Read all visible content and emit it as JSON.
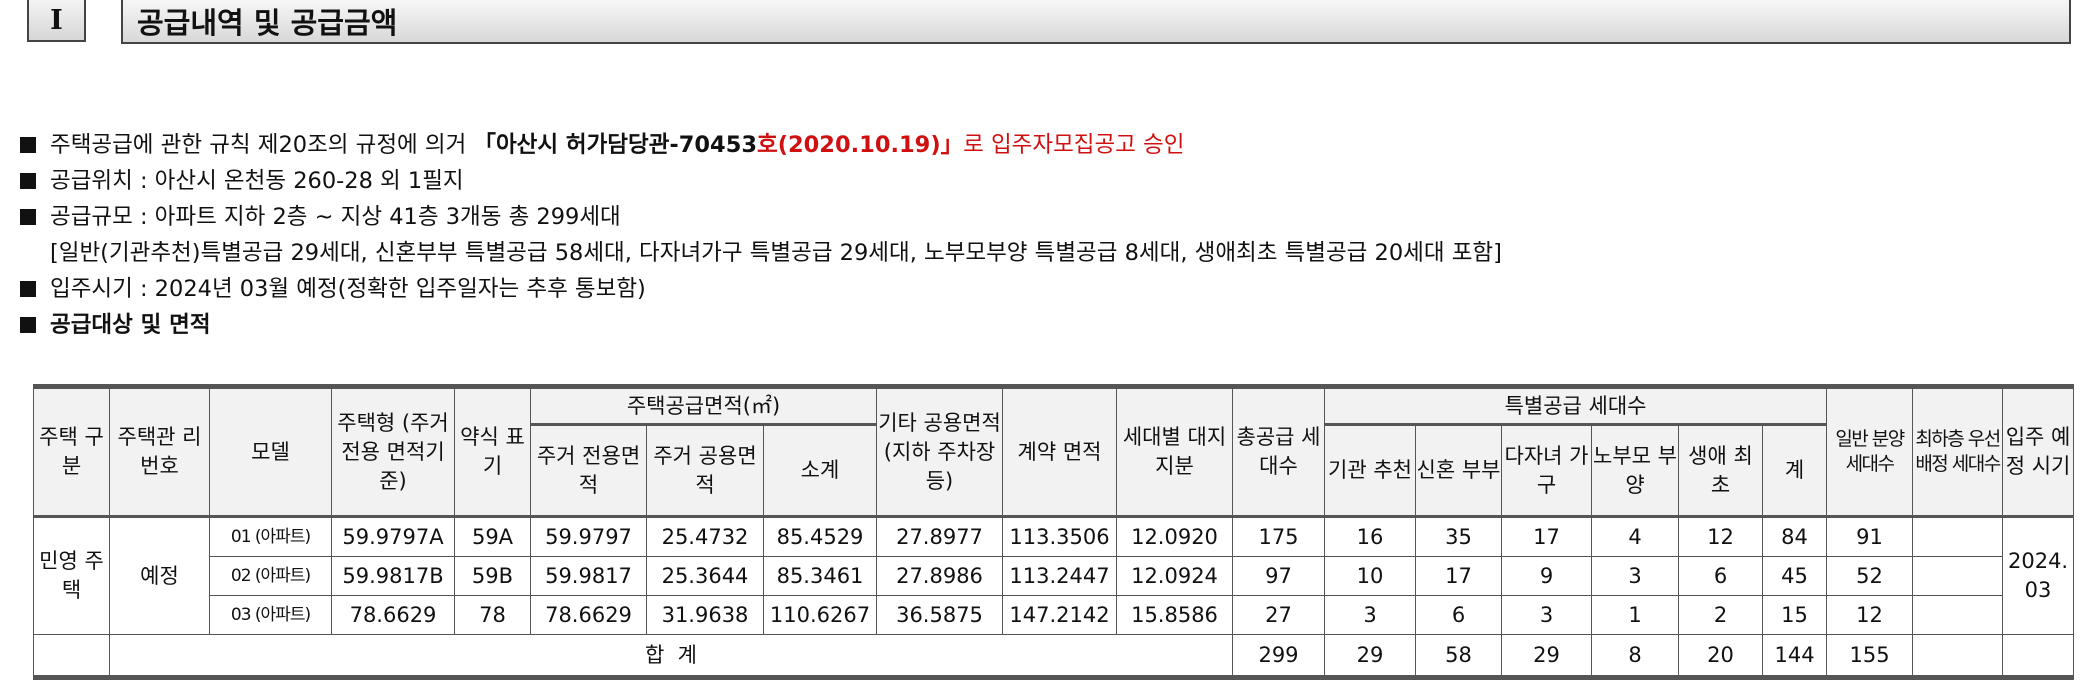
{
  "section": {
    "number": "I",
    "title": "공급내역 및 공급금액"
  },
  "bullets": {
    "b1_prefix": "주택공급에 관한 규칙 제20조의 규정에 의거 ",
    "b1_doc": "「아산시 허가담당관-70453",
    "b1_red": "호(2020.10.19)」",
    "b1_suffix": "로 입주자모집공고 승인",
    "b2": "공급위치 : 아산시 온천동 260-28 외 1필지",
    "b3": "공급규모 : 아파트 지하 2층 ~ 지상 41층 3개동 총 299세대",
    "b3_detail": "[일반(기관추천)특별공급 29세대, 신혼부부 특별공급 58세대, 다자녀가구 특별공급 29세대, 노부모부양 특별공급 8세대, 생애최초 특별공급 20세대 포함]",
    "b4": "입주시기 : 2024년 03월 예정(정확한 입주일자는 추후 통보함)",
    "b5": "공급대상 및 면적"
  },
  "table": {
    "headers": {
      "house_type": "주택 구분",
      "manage_no": "주택관 리번호",
      "model": "모델",
      "house_style": "주택형 (주거전용 면적기준)",
      "abbr": "약식 표기",
      "supply_area": "주택공급면적(㎡)",
      "resid_private": "주거 전용면적",
      "resid_common": "주거 공용면적",
      "subtotal": "소계",
      "other_common": "기타 공용면적 (지하 주차장등)",
      "contract_area": "계약 면적",
      "land_share": "세대별 대지지분",
      "total_units": "총공급 세대수",
      "special": "특별공급 세대수",
      "inst": "기관 추천",
      "newlywed": "신혼 부부",
      "multi_child": "다자녀 가구",
      "elder": "노부모 부양",
      "first_life": "생애 최초",
      "sum": "계",
      "general": "일반 분양 세대수",
      "lowest_floor": "최하층 우선배정 세대수",
      "move_in": "입주 예정 시기"
    },
    "group_label": "민영 주택",
    "manage_value": "예정",
    "move_in_value": "2024. 03",
    "rows": [
      {
        "model": "01 (아파트)",
        "type": "59.9797A",
        "abbr": "59A",
        "priv": "59.9797",
        "common": "25.4732",
        "sub": "85.4529",
        "other": "27.8977",
        "contract": "113.3506",
        "land": "12.0920",
        "total": "175",
        "inst": "16",
        "newly": "35",
        "multi": "17",
        "elder": "4",
        "first": "12",
        "sum": "84",
        "general": "91",
        "lowest": ""
      },
      {
        "model": "02 (아파트)",
        "type": "59.9817B",
        "abbr": "59B",
        "priv": "59.9817",
        "common": "25.3644",
        "sub": "85.3461",
        "other": "27.8986",
        "contract": "113.2447",
        "land": "12.0924",
        "total": "97",
        "inst": "10",
        "newly": "17",
        "multi": "9",
        "elder": "3",
        "first": "6",
        "sum": "45",
        "general": "52",
        "lowest": ""
      },
      {
        "model": "03 (아파트)",
        "type": "78.6629",
        "abbr": "78",
        "priv": "78.6629",
        "common": "31.9638",
        "sub": "110.6267",
        "other": "36.5875",
        "contract": "147.2142",
        "land": "15.8586",
        "total": "27",
        "inst": "3",
        "newly": "6",
        "multi": "3",
        "elder": "1",
        "first": "2",
        "sum": "15",
        "general": "12",
        "lowest": ""
      }
    ],
    "total_row": {
      "label": "합  계",
      "total": "299",
      "inst": "29",
      "newly": "58",
      "multi": "29",
      "elder": "8",
      "first": "20",
      "sum": "144",
      "general": "155"
    }
  }
}
